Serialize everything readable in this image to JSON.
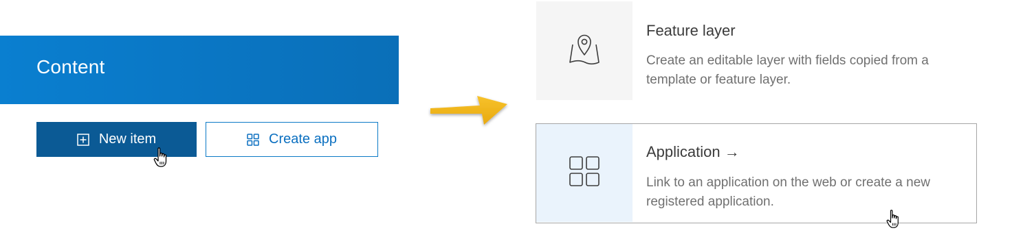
{
  "content_header": {
    "title": "Content"
  },
  "buttons": {
    "new_item_label": "New item",
    "create_app_label": "Create app"
  },
  "cards": [
    {
      "title": "Feature layer",
      "description": "Create an editable layer with fields copied from a template or feature layer.",
      "icon": "map-pin-icon"
    },
    {
      "title": "Application →",
      "description": "Link to an application on the web or create a new registered application.",
      "icon": "app-grid-icon"
    }
  ],
  "colors": {
    "header_blue": "#0a75c2",
    "button_dark_blue": "#0b5a95",
    "link_blue": "#0a6fc0",
    "arrow_yellow": "#f2b418",
    "app_icon_bg": "#eaf3fc"
  }
}
